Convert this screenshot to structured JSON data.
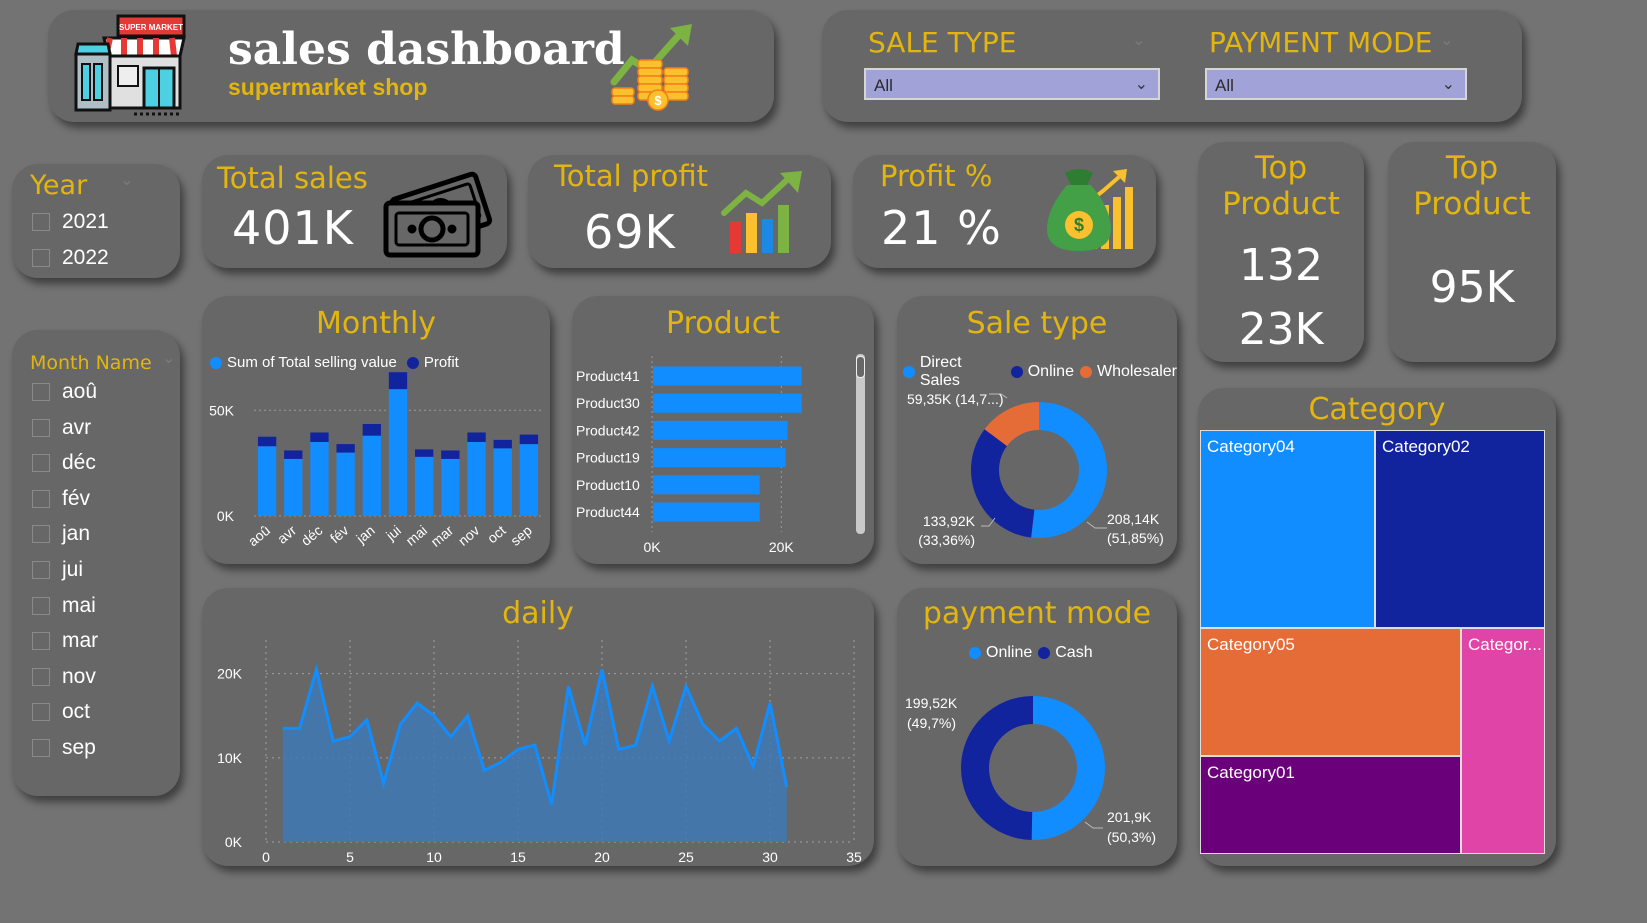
{
  "header": {
    "title": "sales dashboard",
    "subtitle": "supermarket shop",
    "store_sign": "SUPER MARKET"
  },
  "filters": {
    "sale_type": {
      "label": "SALE TYPE",
      "value": "All"
    },
    "payment_mode": {
      "label": "PAYMENT MODE",
      "value": "All"
    }
  },
  "year_slicer": {
    "label": "Year",
    "options": [
      "2021",
      "2022"
    ]
  },
  "month_slicer": {
    "label": "Month Name",
    "options": [
      "aoû",
      "avr",
      "déc",
      "fév",
      "jan",
      "jui",
      "mai",
      "mar",
      "nov",
      "oct",
      "sep"
    ]
  },
  "kpis": {
    "total_sales": {
      "label": "Total sales",
      "value": "401K"
    },
    "total_profit": {
      "label": "Total profit",
      "value": "69K"
    },
    "profit_pct": {
      "label": "Profit %",
      "value": "21 %"
    }
  },
  "top_product_1": {
    "label_line1": "Top",
    "label_line2": "Product",
    "value1": "132",
    "value2": "23K"
  },
  "top_product_2": {
    "label_line1": "Top",
    "label_line2": "Product",
    "value": "95K"
  },
  "colors": {
    "gold": "#e3b50f",
    "blue": "#118dff",
    "navy": "#12239e",
    "orange": "#e66c37",
    "purple": "#6b007b",
    "pink": "#e044a7"
  },
  "icons": [
    "store-icon",
    "money-coins-icon",
    "cash-icon",
    "growth-chart-icon",
    "money-bag-icon"
  ],
  "chart_data": [
    {
      "id": "monthly",
      "type": "bar",
      "title": "Monthly",
      "categories": [
        "aoû",
        "avr",
        "déc",
        "fév",
        "jan",
        "jui",
        "mai",
        "mar",
        "nov",
        "oct",
        "sep"
      ],
      "series": [
        {
          "name": "Sum of Total selling value",
          "values": [
            33000,
            27000,
            35000,
            30000,
            38000,
            60000,
            28000,
            27000,
            35000,
            32000,
            34000
          ]
        },
        {
          "name": "Profit",
          "values": [
            4500,
            4000,
            4500,
            4000,
            5500,
            8000,
            3500,
            4000,
            4500,
            4000,
            4500
          ]
        }
      ],
      "stacked": true,
      "yticks": [
        "0K",
        "50K"
      ],
      "ylim": [
        0,
        70000
      ]
    },
    {
      "id": "product",
      "type": "bar",
      "orientation": "horizontal",
      "title": "Product",
      "categories": [
        "Product41",
        "Product30",
        "Product42",
        "Product19",
        "Product10",
        "Product44"
      ],
      "values": [
        23000,
        23000,
        20800,
        20500,
        16500,
        16500
      ],
      "xticks": [
        "0K",
        "20K"
      ],
      "xlim": [
        0,
        30000
      ]
    },
    {
      "id": "sale_type",
      "type": "pie",
      "title": "Sale type",
      "donut": true,
      "labels": [
        "Direct Sales",
        "Online",
        "Wholesaler"
      ],
      "values": [
        208.14,
        133.92,
        59.35
      ],
      "data_labels": [
        {
          "line1": "208,14K",
          "line2": "(51,85%)"
        },
        {
          "line1": "133,92K",
          "line2": "(33,36%)"
        },
        {
          "line1": "59,35K (14,7...)",
          "line2": ""
        }
      ]
    },
    {
      "id": "daily",
      "type": "area",
      "title": "daily",
      "x": [
        1,
        2,
        3,
        4,
        5,
        6,
        7,
        8,
        9,
        10,
        11,
        12,
        13,
        14,
        15,
        16,
        17,
        18,
        19,
        20,
        21,
        22,
        23,
        24,
        25,
        26,
        27,
        28,
        29,
        30,
        31
      ],
      "values": [
        13500,
        13500,
        20500,
        12000,
        12500,
        14500,
        7000,
        14000,
        16500,
        15000,
        12500,
        15000,
        8500,
        9500,
        11000,
        11500,
        4500,
        18500,
        11500,
        20500,
        11000,
        11500,
        18500,
        12000,
        18500,
        14000,
        12000,
        13500,
        9000,
        16500,
        6500
      ],
      "xticks": [
        "0",
        "5",
        "10",
        "15",
        "20",
        "25",
        "30",
        "35"
      ],
      "yticks": [
        "0K",
        "10K",
        "20K"
      ],
      "xlim": [
        0,
        35
      ],
      "ylim": [
        0,
        24000
      ]
    },
    {
      "id": "payment_mode",
      "type": "pie",
      "title": "payment mode",
      "donut": true,
      "labels": [
        "Online",
        "Cash"
      ],
      "values": [
        201.9,
        199.52
      ],
      "data_labels": [
        {
          "line1": "201,9K",
          "line2": "(50,3%)"
        },
        {
          "line1": "199,52K",
          "line2": "(49,7%)"
        }
      ]
    },
    {
      "id": "category",
      "type": "treemap",
      "title": "Category",
      "labels": [
        "Category04",
        "Category02",
        "Category05",
        "Categor...",
        "Category01"
      ]
    }
  ]
}
